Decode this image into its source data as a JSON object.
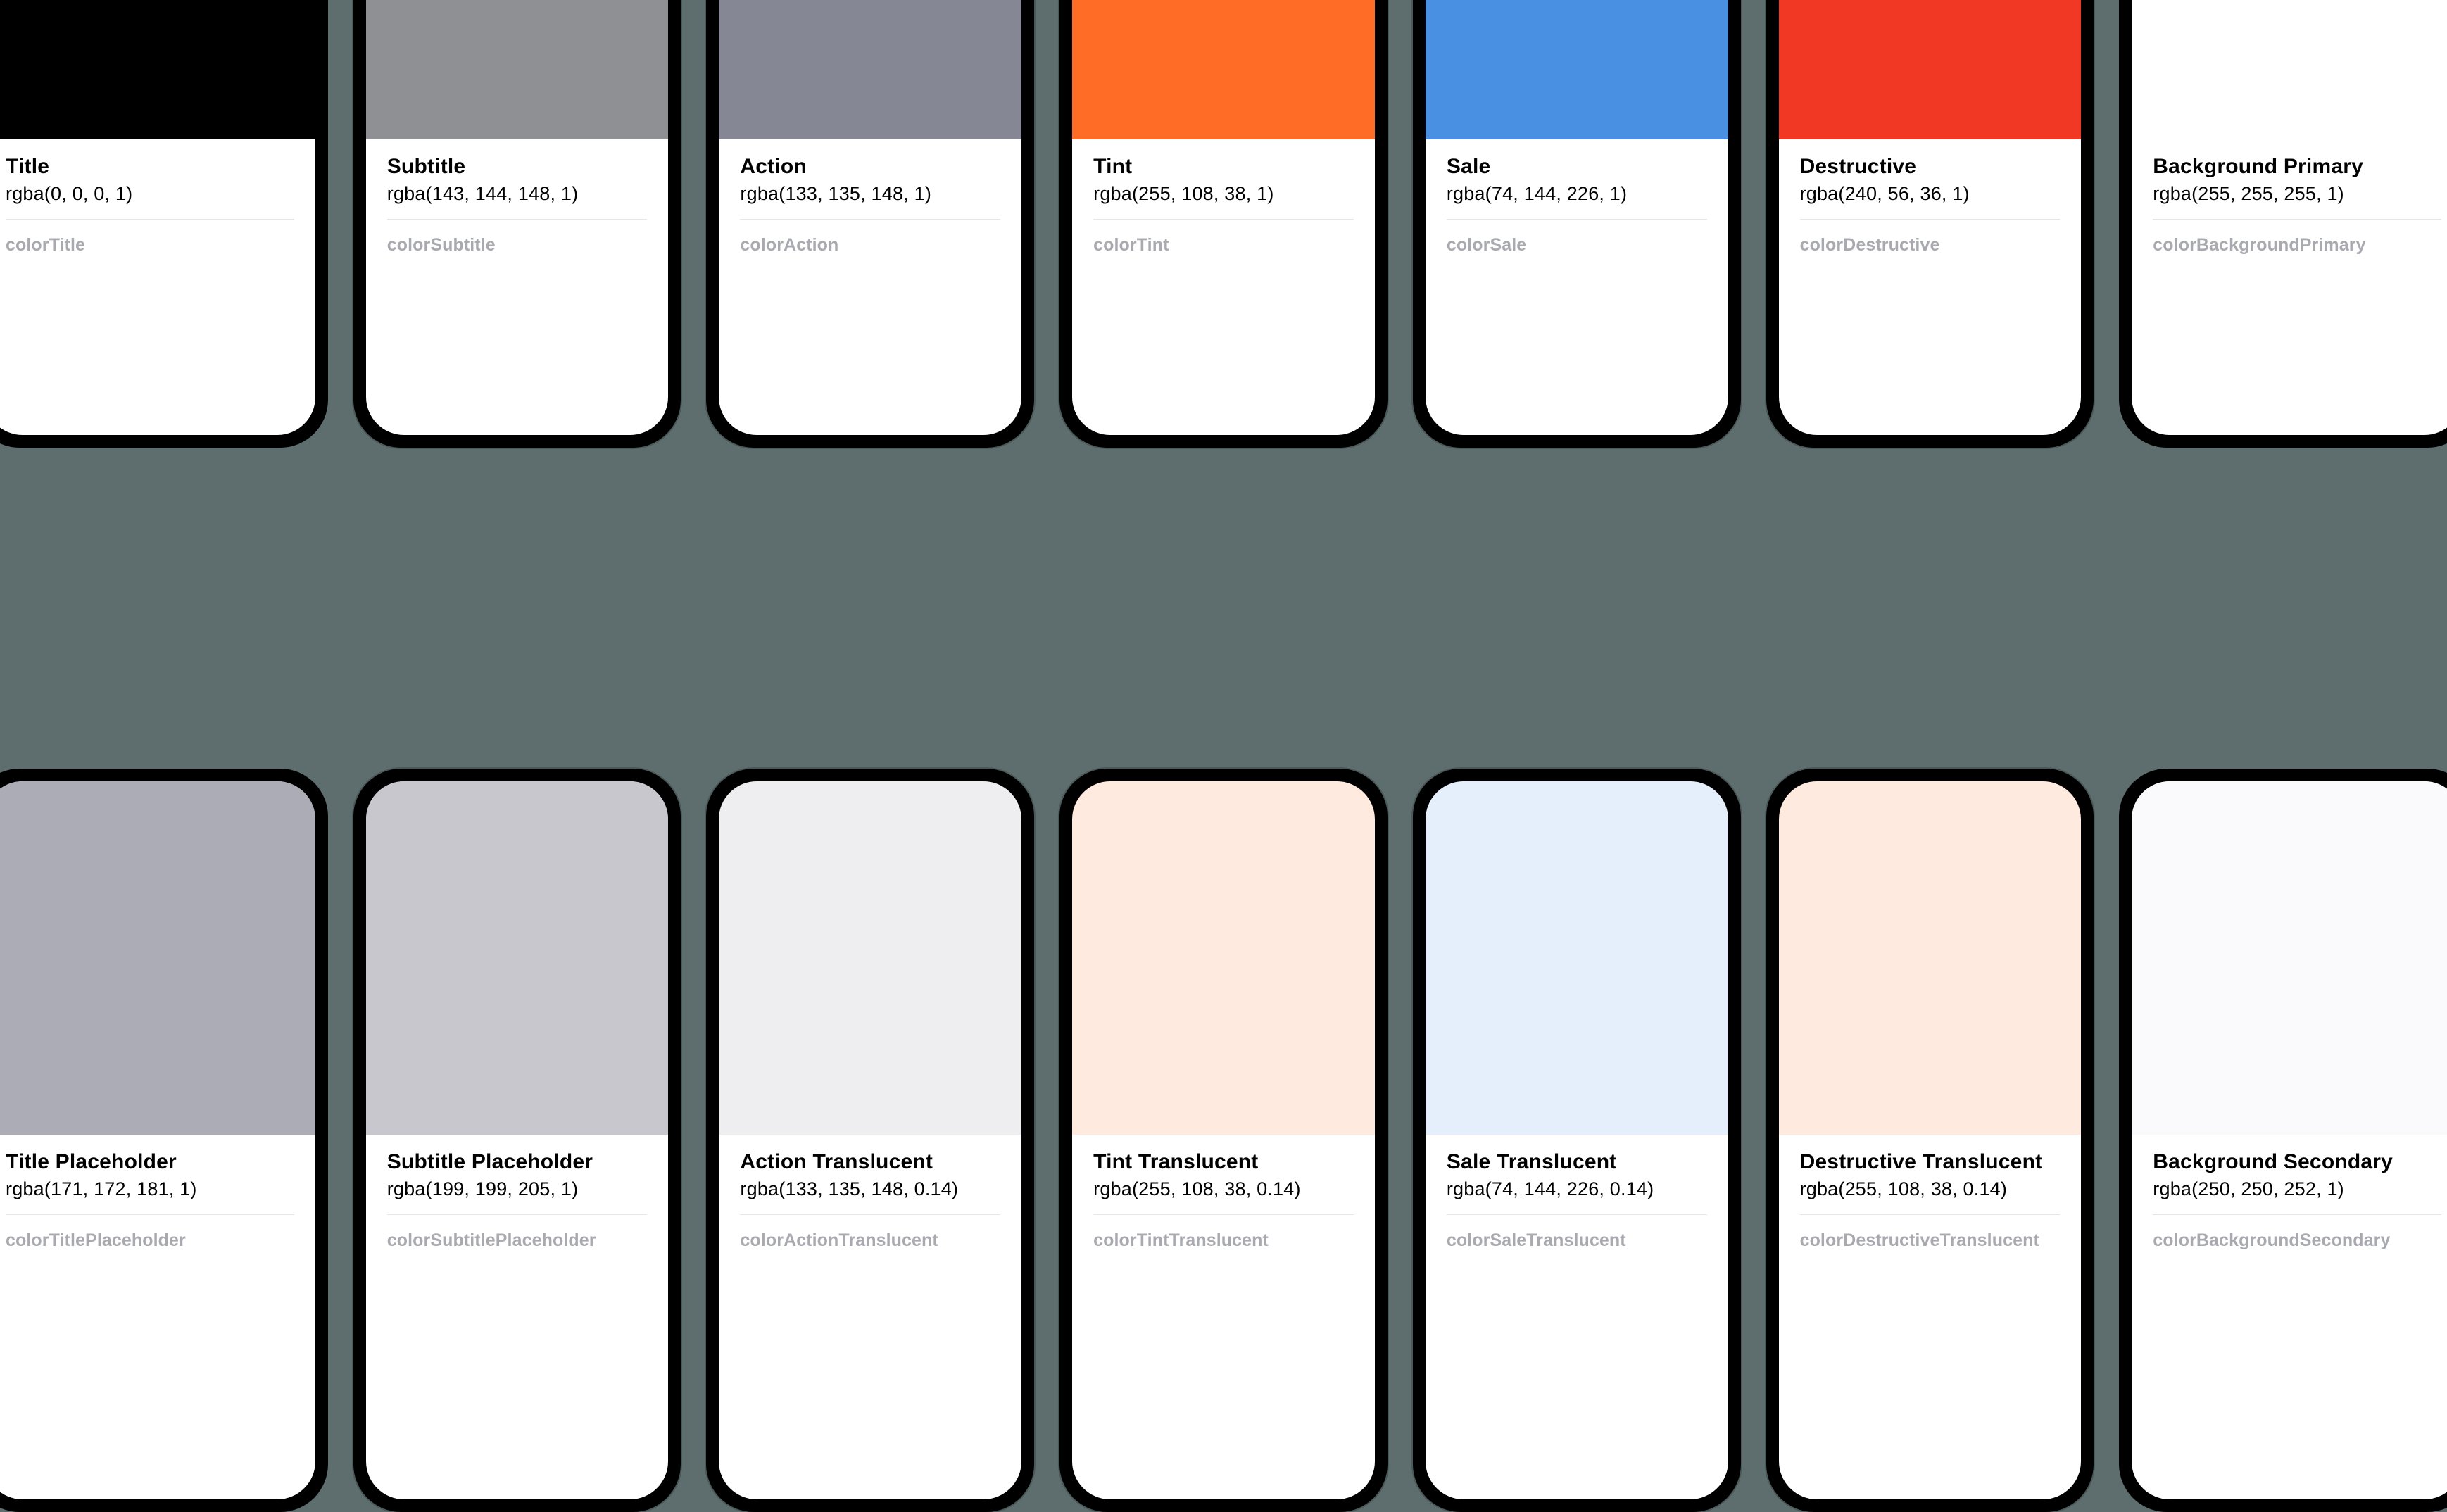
{
  "swatches": [
    {
      "name": "Title",
      "rgba": "rgba(0, 0, 0, 1)",
      "token": "colorTitle",
      "hex": "#000000"
    },
    {
      "name": "Subtitle",
      "rgba": "rgba(143, 144, 148, 1)",
      "token": "colorSubtitle",
      "hex": "#8f9094"
    },
    {
      "name": "Action",
      "rgba": "rgba(133, 135, 148, 1)",
      "token": "colorAction",
      "hex": "#858794"
    },
    {
      "name": "Tint",
      "rgba": "rgba(255, 108, 38, 1)",
      "token": "colorTint",
      "hex": "#ff6c26"
    },
    {
      "name": "Sale",
      "rgba": "rgba(74, 144, 226, 1)",
      "token": "colorSale",
      "hex": "#4a90e2"
    },
    {
      "name": "Destructive",
      "rgba": "rgba(240, 56, 36, 1)",
      "token": "colorDestructive",
      "hex": "#f03824"
    },
    {
      "name": "Background Primary",
      "rgba": "rgba(255, 255, 255, 1)",
      "token": "colorBackgroundPrimary",
      "hex": "#ffffff"
    },
    {
      "name": "Title Placeholder",
      "rgba": "rgba(171, 172, 181, 1)",
      "token": "colorTitlePlaceholder",
      "hex": "#abacb5"
    },
    {
      "name": "Subtitle Placeholder",
      "rgba": "rgba(199, 199, 205, 1)",
      "token": "colorSubtitlePlaceholder",
      "hex": "#c7c7cd"
    },
    {
      "name": "Action Translucent",
      "rgba": "rgba(133, 135, 148, 0.14)",
      "token": "colorActionTranslucent",
      "hex": "rgba(133,135,148,0.14)"
    },
    {
      "name": "Tint Translucent",
      "rgba": "rgba(255, 108, 38, 0.14)",
      "token": "colorTintTranslucent",
      "hex": "rgba(255,108,38,0.14)"
    },
    {
      "name": "Sale Translucent",
      "rgba": "rgba(74, 144, 226, 0.14)",
      "token": "colorSaleTranslucent",
      "hex": "rgba(74,144,226,0.14)"
    },
    {
      "name": "Destructive Translucent",
      "rgba": "rgba(255, 108, 38, 0.14)",
      "token": "colorDestructiveTranslucent",
      "hex": "rgba(255,108,38,0.14)"
    },
    {
      "name": "Background Secondary",
      "rgba": "rgba(250, 250, 252, 1)",
      "token": "colorBackgroundSecondary",
      "hex": "#fafafc"
    }
  ]
}
